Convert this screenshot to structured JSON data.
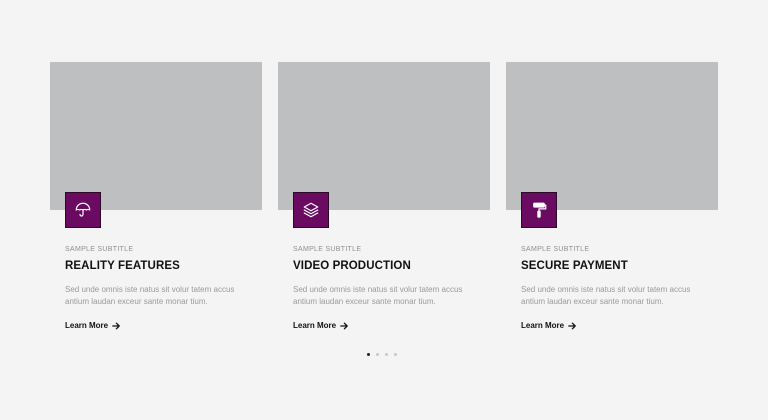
{
  "cards": [
    {
      "subtitle": "SAMPLE SUBTITLE",
      "title": "REALITY FEATURES",
      "description": "Sed unde omnis iste natus sit volur tatem accus antium laudan exceur sante monar tium.",
      "link_label": "Learn More",
      "icon": "umbrella-icon"
    },
    {
      "subtitle": "SAMPLE SUBTITLE",
      "title": "VIDEO PRODUCTION",
      "description": "Sed unde omnis iste natus sit volur tatem accus antium laudan exceur sante monar tium.",
      "link_label": "Learn More",
      "icon": "layers-icon"
    },
    {
      "subtitle": "SAMPLE SUBTITLE",
      "title": "SECURE PAYMENT",
      "description": "Sed unde omnis iste natus sit volur tatem accus antium laudan exceur sante monar tium.",
      "link_label": "Learn More",
      "icon": "paint-roller-icon"
    }
  ],
  "carousel": {
    "page_count": 4,
    "active_index": 0
  },
  "colors": {
    "icon_background": "#6a0a60",
    "image_placeholder": "#bebfc1",
    "page_background": "#f4f4f4"
  }
}
